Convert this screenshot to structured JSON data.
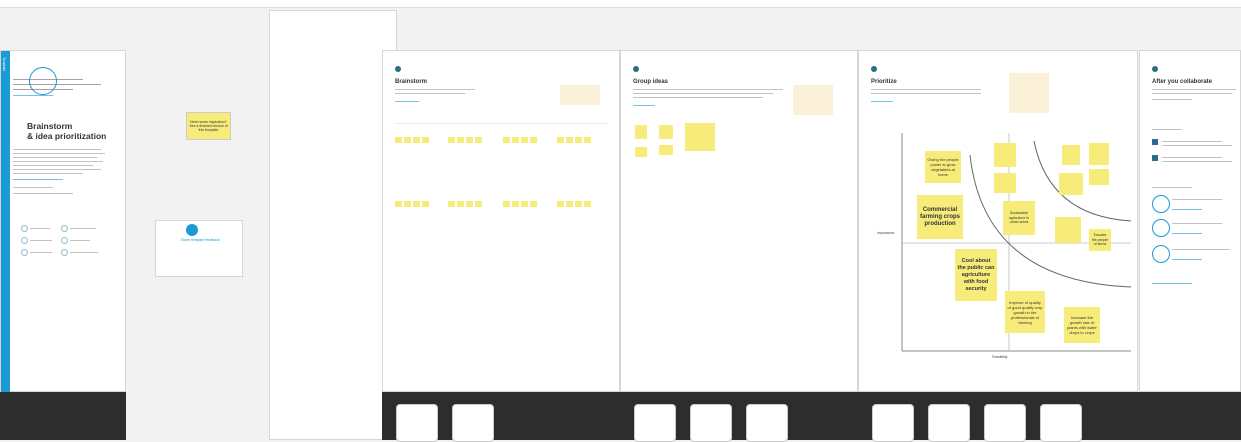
{
  "left_panel": {
    "tab_label": "Template",
    "heading_line1": "Brainstorm",
    "heading_line2": "& idea prioritization"
  },
  "board_panel": {
    "card_text": "Share template feedback",
    "sticky_text": "Need some inspiration? See a finished version of this template"
  },
  "frames": [
    {
      "title": "Brainstorm"
    },
    {
      "title": "Group ideas"
    },
    {
      "title": "Prioritize"
    },
    {
      "title": "After you collaborate"
    }
  ],
  "prioritize_grid": {
    "stickies": [
      "Giving the people power to grow vegetables at home",
      "Commercial farming crops production",
      "Cool about the public can agriculture with food security",
      "Improve of quality of good quality crop growth in the professionals of farming",
      "Sustainable agriculture in urban areas",
      "Educate the people of farms",
      "Increase the growth rate of plants with water drops to crops"
    ],
    "x_label": "Feasibility",
    "y_label": "Importance"
  },
  "colors": {
    "accent": "#1a9ad6",
    "sticky": "#f7ec7a",
    "note": "#fbf0d8",
    "dark": "#2d2d2d"
  }
}
